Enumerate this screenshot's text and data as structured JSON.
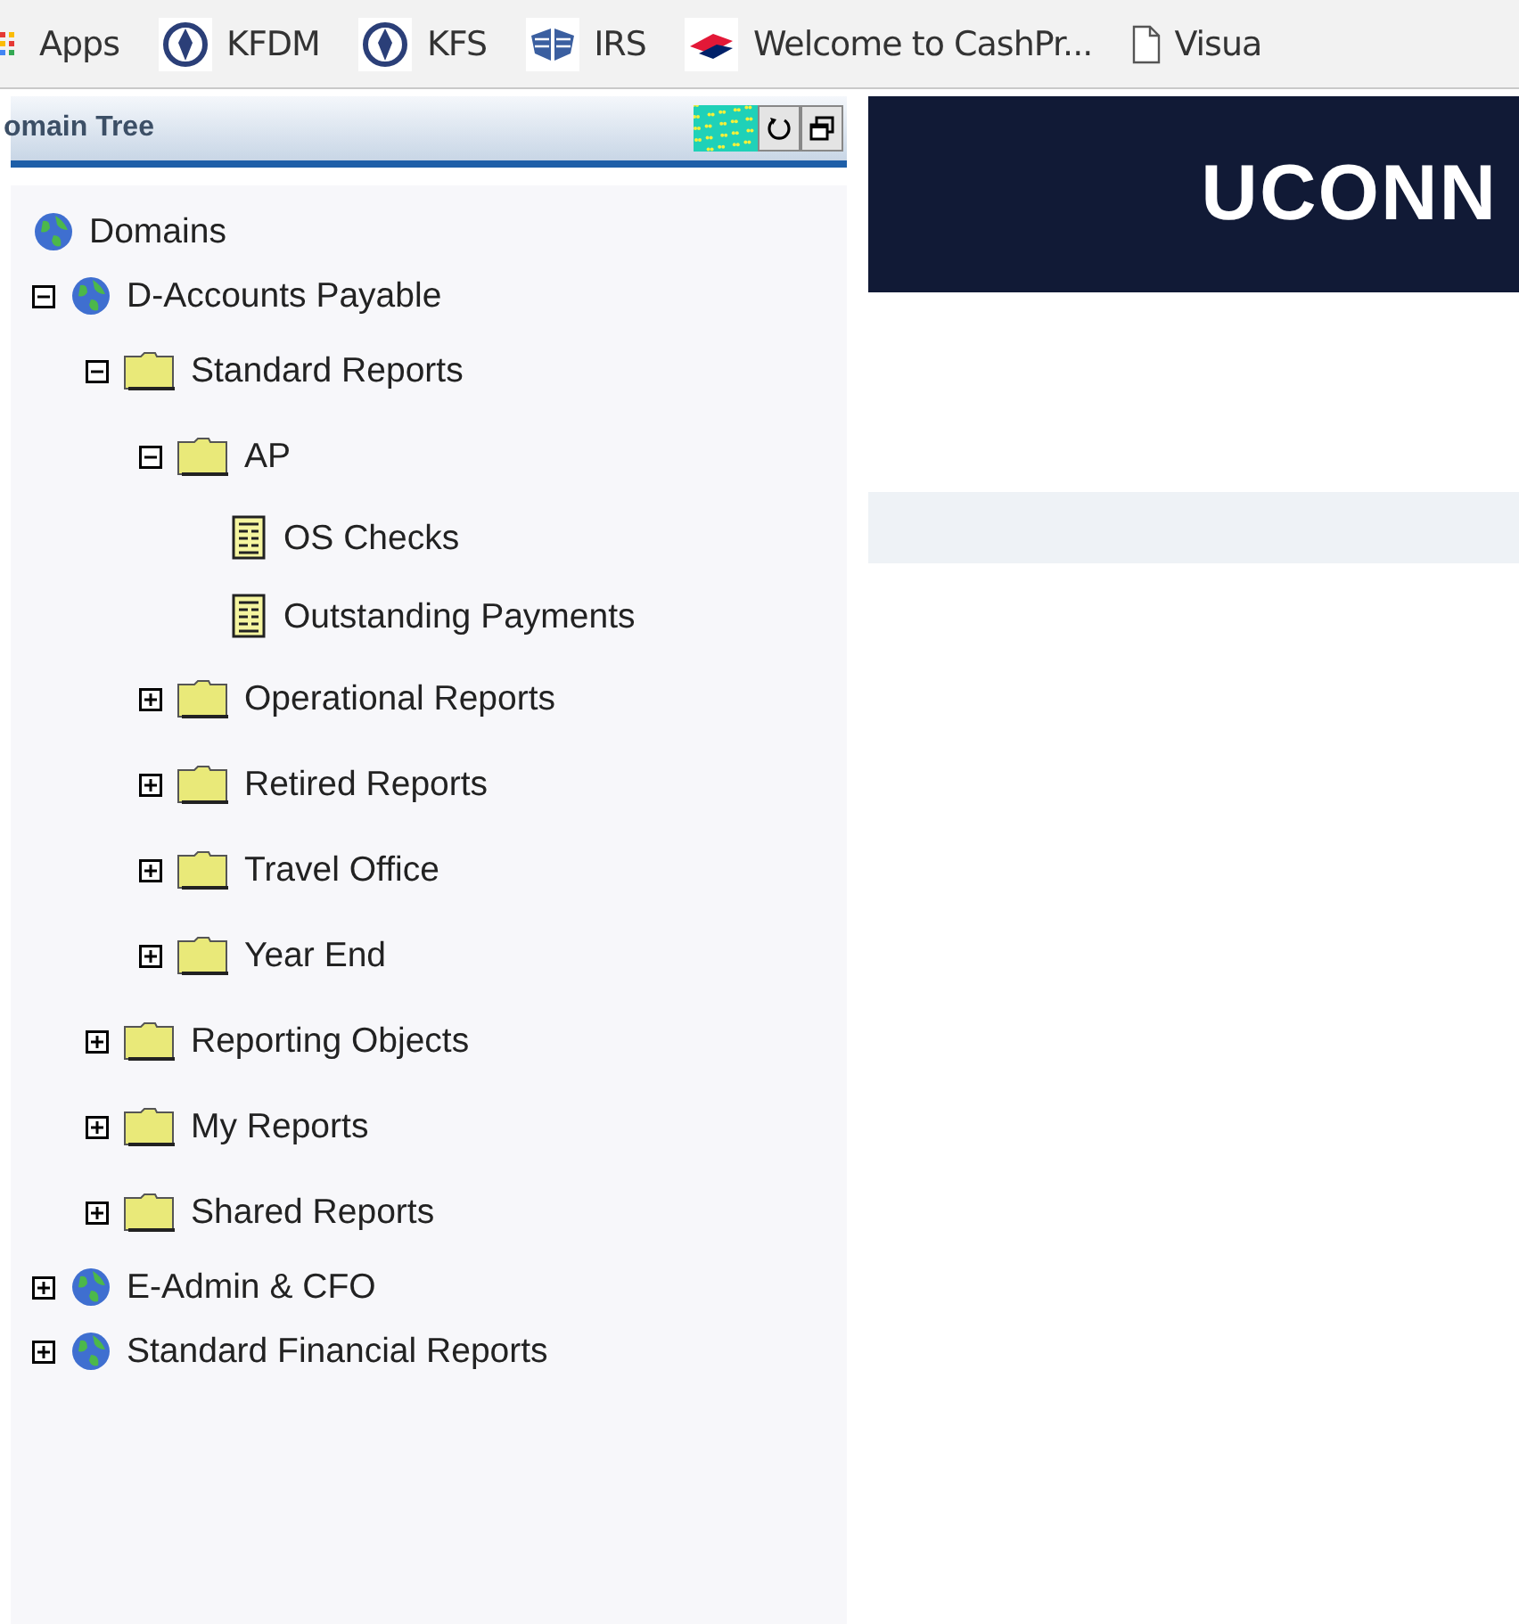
{
  "bookmarks": [
    {
      "label": "Apps",
      "kind": "apps"
    },
    {
      "label": "KFDM",
      "kind": "seal"
    },
    {
      "label": "KFS",
      "kind": "seal"
    },
    {
      "label": "IRS",
      "kind": "eagle"
    },
    {
      "label": "Welcome to CashPr...",
      "kind": "bank"
    },
    {
      "label": "Visua",
      "kind": "page"
    }
  ],
  "panel": {
    "title": "omain Tree"
  },
  "tree": [
    {
      "label": "Domains",
      "kind": "domain",
      "children": [
        {
          "label": "D-Accounts Payable",
          "kind": "domain",
          "expanded": true,
          "children": [
            {
              "label": "Standard Reports",
              "kind": "folder",
              "expanded": true,
              "children": [
                {
                  "label": "AP",
                  "kind": "folder",
                  "expanded": true,
                  "children": [
                    {
                      "label": "OS Checks",
                      "kind": "report"
                    },
                    {
                      "label": "Outstanding Payments",
                      "kind": "report"
                    }
                  ]
                },
                {
                  "label": "Operational Reports",
                  "kind": "folder",
                  "expanded": false
                },
                {
                  "label": "Retired Reports",
                  "kind": "folder",
                  "expanded": false
                },
                {
                  "label": "Travel Office",
                  "kind": "folder",
                  "expanded": false
                },
                {
                  "label": "Year End",
                  "kind": "folder",
                  "expanded": false
                }
              ]
            },
            {
              "label": "Reporting Objects",
              "kind": "folder",
              "expanded": false
            },
            {
              "label": "My Reports",
              "kind": "folder",
              "expanded": false
            },
            {
              "label": "Shared Reports",
              "kind": "folder",
              "expanded": false
            }
          ]
        },
        {
          "label": "E-Admin & CFO",
          "kind": "domain",
          "expanded": false
        },
        {
          "label": "Standard Financial Reports",
          "kind": "domain",
          "expanded": false
        }
      ]
    }
  ],
  "banner": {
    "title": "UCONN"
  }
}
